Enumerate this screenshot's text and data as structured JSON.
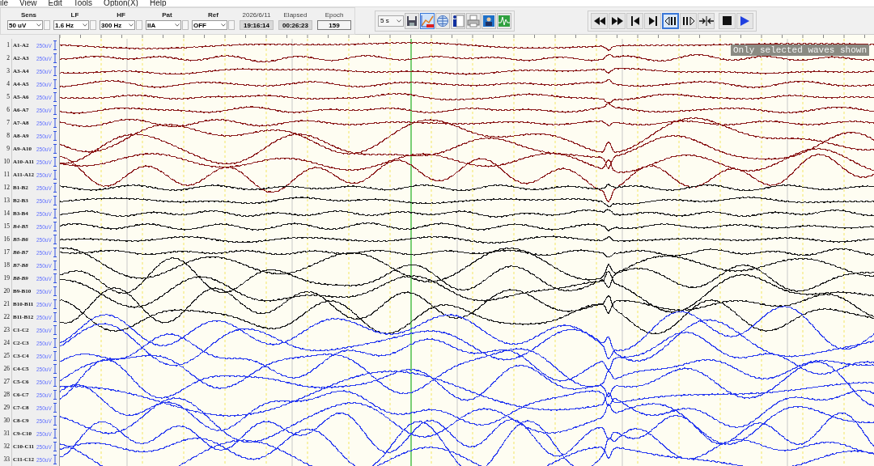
{
  "menu": [
    {
      "label": "ile"
    },
    {
      "label": "View"
    },
    {
      "label": "Edit"
    },
    {
      "label": "Tools"
    },
    {
      "label": "Option(X)"
    },
    {
      "label": "Help"
    }
  ],
  "toolbar": {
    "fields": [
      {
        "label": "Sens",
        "value": "50 uV"
      },
      {
        "label": "LF",
        "value": "1.6 Hz"
      },
      {
        "label": "HF",
        "value": "300 Hz"
      },
      {
        "label": "Pat",
        "value": "IIA"
      },
      {
        "label": "Ref",
        "value": "OFF"
      }
    ],
    "readouts": [
      {
        "label": "2026/6/11",
        "value": "19:16:14",
        "kind": "raised"
      },
      {
        "label": "Elapsed",
        "value": "00:26:23",
        "kind": "raised"
      },
      {
        "label": "Epoch",
        "value": "159",
        "kind": "sunken"
      }
    ],
    "page_length": "5 s",
    "tools": [
      {
        "kind": "save",
        "selected": false
      },
      {
        "kind": "chart-on",
        "selected": true
      },
      {
        "kind": "globe",
        "selected": false
      },
      {
        "kind": "info",
        "selected": false
      },
      {
        "kind": "print",
        "selected": false
      },
      {
        "kind": "image",
        "selected": false
      },
      {
        "kind": "chart",
        "selected": false
      }
    ],
    "playback": [
      {
        "kind": "rewind",
        "selected": false
      },
      {
        "kind": "forward",
        "selected": false
      },
      {
        "kind": "start",
        "selected": false
      },
      {
        "kind": "end",
        "selected": false
      },
      {
        "kind": "step-back",
        "selected": true
      },
      {
        "kind": "step-forward",
        "selected": false
      },
      {
        "kind": "collapse",
        "selected": false
      },
      {
        "kind": "stop",
        "selected": false
      },
      {
        "kind": "play",
        "selected": false
      }
    ]
  },
  "channels": [
    {
      "number": "1",
      "label": "A1-A2",
      "scale": "250uV",
      "color": "#8b1a1a",
      "italic": false
    },
    {
      "number": "2",
      "label": "A2-A3",
      "scale": "250uV",
      "color": "#8b1a1a",
      "italic": false
    },
    {
      "number": "3",
      "label": "A3-A4",
      "scale": "250uV",
      "color": "#8b1a1a",
      "italic": false
    },
    {
      "number": "4",
      "label": "A4-A5",
      "scale": "250uV",
      "color": "#8b1a1a",
      "italic": false
    },
    {
      "number": "5",
      "label": "A5-A6",
      "scale": "250uV",
      "color": "#8b1a1a",
      "italic": false
    },
    {
      "number": "6",
      "label": "A6-A7",
      "scale": "250uV",
      "color": "#8b1a1a",
      "italic": false
    },
    {
      "number": "7",
      "label": "A7-A8",
      "scale": "250uV",
      "color": "#8b1a1a",
      "italic": false
    },
    {
      "number": "8",
      "label": "A8-A9",
      "scale": "250uV",
      "color": "#8b1a1a",
      "italic": false
    },
    {
      "number": "9",
      "label": "A9-A10",
      "scale": "250uV",
      "color": "#8b1a1a",
      "italic": false
    },
    {
      "number": "10",
      "label": "A10-A11",
      "scale": "250uV",
      "color": "#8b1a1a",
      "italic": false
    },
    {
      "number": "11",
      "label": "A11-A12",
      "scale": "250uV",
      "color": "#8b1a1a",
      "italic": false
    },
    {
      "number": "12",
      "label": "B1-B2",
      "scale": "250uV",
      "color": "#1a1a1a",
      "italic": false
    },
    {
      "number": "13",
      "label": "B2-B3",
      "scale": "250uV",
      "color": "#1a1a1a",
      "italic": false
    },
    {
      "number": "14",
      "label": "B3-B4",
      "scale": "250uV",
      "color": "#1a1a1a",
      "italic": false
    },
    {
      "number": "15",
      "label": "B4-B5",
      "scale": "250uV",
      "color": "#1a1a1a",
      "italic": true
    },
    {
      "number": "16",
      "label": "B5-B6",
      "scale": "250uV",
      "color": "#1a1a1a",
      "italic": true
    },
    {
      "number": "17",
      "label": "B6-B7",
      "scale": "250uV",
      "color": "#1a1a1a",
      "italic": true
    },
    {
      "number": "18",
      "label": "B7-B8",
      "scale": "250uV",
      "color": "#1a1a1a",
      "italic": true
    },
    {
      "number": "19",
      "label": "B8-B9",
      "scale": "250uV",
      "color": "#1a1a1a",
      "italic": true
    },
    {
      "number": "20",
      "label": "B9-B10",
      "scale": "250uV",
      "color": "#1a1a1a",
      "italic": false
    },
    {
      "number": "21",
      "label": "B10-B11",
      "scale": "250uV",
      "color": "#1a1a1a",
      "italic": false
    },
    {
      "number": "22",
      "label": "B11-B12",
      "scale": "250uV",
      "color": "#1a1a1a",
      "italic": false
    },
    {
      "number": "23",
      "label": "C1-C2",
      "scale": "250uV",
      "color": "#2a3cf0",
      "italic": false
    },
    {
      "number": "24",
      "label": "C2-C3",
      "scale": "250uV",
      "color": "#2a3cf0",
      "italic": false
    },
    {
      "number": "25",
      "label": "C3-C4",
      "scale": "250uV",
      "color": "#2a3cf0",
      "italic": false
    },
    {
      "number": "26",
      "label": "C4-C5",
      "scale": "250uV",
      "color": "#2a3cf0",
      "italic": false
    },
    {
      "number": "27",
      "label": "C5-C6",
      "scale": "250uV",
      "color": "#2a3cf0",
      "italic": false
    },
    {
      "number": "28",
      "label": "C6-C7",
      "scale": "250uV",
      "color": "#2a3cf0",
      "italic": false
    },
    {
      "number": "29",
      "label": "C7-C8",
      "scale": "250uV",
      "color": "#2a3cf0",
      "italic": false
    },
    {
      "number": "30",
      "label": "C8-C9",
      "scale": "250uV",
      "color": "#2a3cf0",
      "italic": false
    },
    {
      "number": "31",
      "label": "C9-C10",
      "scale": "250uV",
      "color": "#2a3cf0",
      "italic": false
    },
    {
      "number": "32",
      "label": "C10-C11",
      "scale": "250uV",
      "color": "#2a3cf0",
      "italic": false
    },
    {
      "number": "33",
      "label": "C11-C12",
      "scale": "250uV",
      "color": "#2a3cf0",
      "italic": false
    }
  ],
  "overlay_message": "Only selected waves shown"
}
